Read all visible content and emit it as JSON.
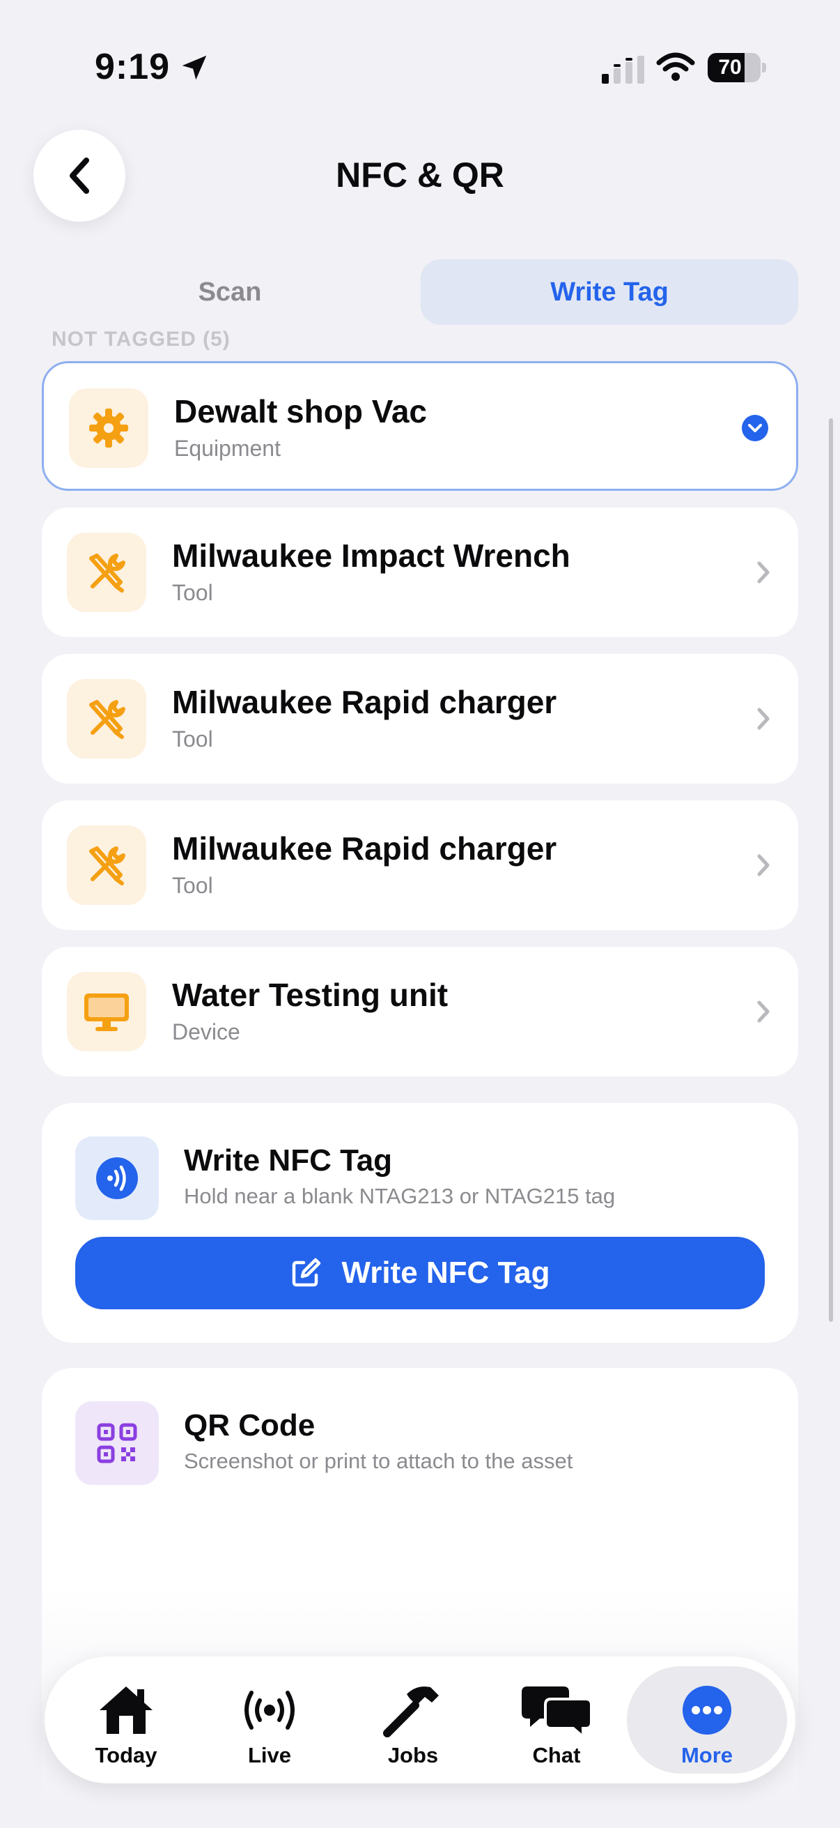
{
  "status_bar": {
    "time": "9:19",
    "battery_text": "70",
    "battery_level": 0.7
  },
  "header": {
    "title": "NFC & QR"
  },
  "tabs": [
    {
      "label": "Scan",
      "active": false
    },
    {
      "label": "Write Tag",
      "active": true
    }
  ],
  "section_label": "NOT TAGGED (5)",
  "assets": [
    {
      "name": "Dewalt shop Vac",
      "type": "Equipment",
      "icon": "gear-icon",
      "selected": true
    },
    {
      "name": "Milwaukee Impact Wrench",
      "type": "Tool",
      "icon": "tools-icon",
      "selected": false
    },
    {
      "name": "Milwaukee Rapid charger",
      "type": "Tool",
      "icon": "tools-icon",
      "selected": false
    },
    {
      "name": "Milwaukee Rapid charger",
      "type": "Tool",
      "icon": "tools-icon",
      "selected": false
    },
    {
      "name": "Water Testing unit",
      "type": "Device",
      "icon": "monitor-icon",
      "selected": false
    }
  ],
  "nfc_card": {
    "title": "Write NFC Tag",
    "subtitle": "Hold near a blank NTAG213 or NTAG215 tag",
    "button_label": "Write NFC Tag"
  },
  "qr_card": {
    "title": "QR Code",
    "subtitle": "Screenshot or print to attach to the asset"
  },
  "nav": [
    {
      "label": "Today",
      "icon": "house-icon",
      "active": false
    },
    {
      "label": "Live",
      "icon": "broadcast-icon",
      "active": false
    },
    {
      "label": "Jobs",
      "icon": "hammer-icon",
      "active": false
    },
    {
      "label": "Chat",
      "icon": "chat-bubbles-icon",
      "active": false
    },
    {
      "label": "More",
      "icon": "more-icon",
      "active": true
    }
  ],
  "colors": {
    "accent": "#2463eb",
    "background": "#f1f1f6",
    "asset_icon_bg": "#fdf1e0",
    "asset_icon_fg": "#f5a012"
  }
}
